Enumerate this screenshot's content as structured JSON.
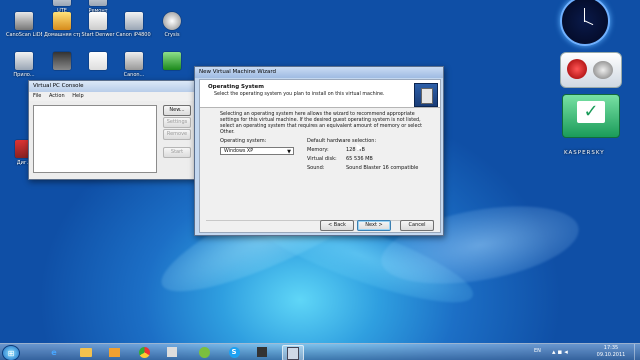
{
  "desktop_icons": [
    {
      "label": "UTE",
      "icon": "app-icon"
    },
    {
      "label": "Ремонт",
      "icon": "app-icon"
    },
    {
      "label": "",
      "icon": "app-icon"
    },
    {
      "label": "",
      "icon": "app-icon"
    },
    {
      "label": "CanoScan LiDE 600F ...",
      "icon": "scanner-icon"
    },
    {
      "label": "Домашняя страница P...",
      "icon": "home-icon"
    },
    {
      "label": "Start Denwer",
      "icon": "denwer-icon"
    },
    {
      "label": "Canon iP4800 seri...",
      "icon": "printer-icon"
    },
    {
      "label": "Crysis",
      "icon": "game-icon"
    },
    {
      "label": "",
      "icon": "camera-icon"
    },
    {
      "label": "Прило...",
      "icon": "app-icon"
    },
    {
      "label": "",
      "icon": "app-icon"
    },
    {
      "label": "",
      "icon": "app-icon"
    },
    {
      "label": "Canon...",
      "icon": "printer-icon"
    },
    {
      "label": "",
      "icon": "check-icon"
    },
    {
      "label": "Диг...",
      "icon": "app-icon"
    }
  ],
  "vpc_console": {
    "title": "Virtual PC Console",
    "menu": [
      "File",
      "Action",
      "Help"
    ],
    "buttons": {
      "new": "New...",
      "settings": "Settings",
      "remove": "Remove",
      "start": "Start"
    }
  },
  "wizard": {
    "title": "New Virtual Machine Wizard",
    "heading": "Operating System",
    "subheading": "Select the operating system you plan to install on this virtual machine.",
    "description": "Selecting an operating system here allows the wizard to recommend appropriate settings for this virtual machine. If the desired guest operating system is not listed, select an operating system that requires an equivalent amount of memory or select Other.",
    "os_label": "Operating system:",
    "os_value": "Windows XP",
    "hw_label": "Default hardware selection:",
    "hw": [
      {
        "key": "Memory:",
        "value": "128 MB"
      },
      {
        "key": "Virtual disk:",
        "value": "65 536 MB"
      },
      {
        "key": "Sound:",
        "value": "Sound Blaster 16 compatible"
      }
    ],
    "back": "< Back",
    "next": "Next >",
    "cancel": "Cancel"
  },
  "gadgets": {
    "kaspersky": "KASPERSKY"
  },
  "taskbar": {
    "items": [
      "start-orb-icon",
      "ie-icon",
      "folder-icon",
      "media-icon",
      "chrome-icon",
      "app-icon",
      "torrent-icon",
      "skype-icon",
      "app-icon",
      "virtual-pc-icon"
    ],
    "lang": "EN",
    "time": "17:35",
    "date": "09.10.2011"
  },
  "colors": {
    "accent": "#3a7bd5",
    "desktop": "#1c6fc6"
  }
}
